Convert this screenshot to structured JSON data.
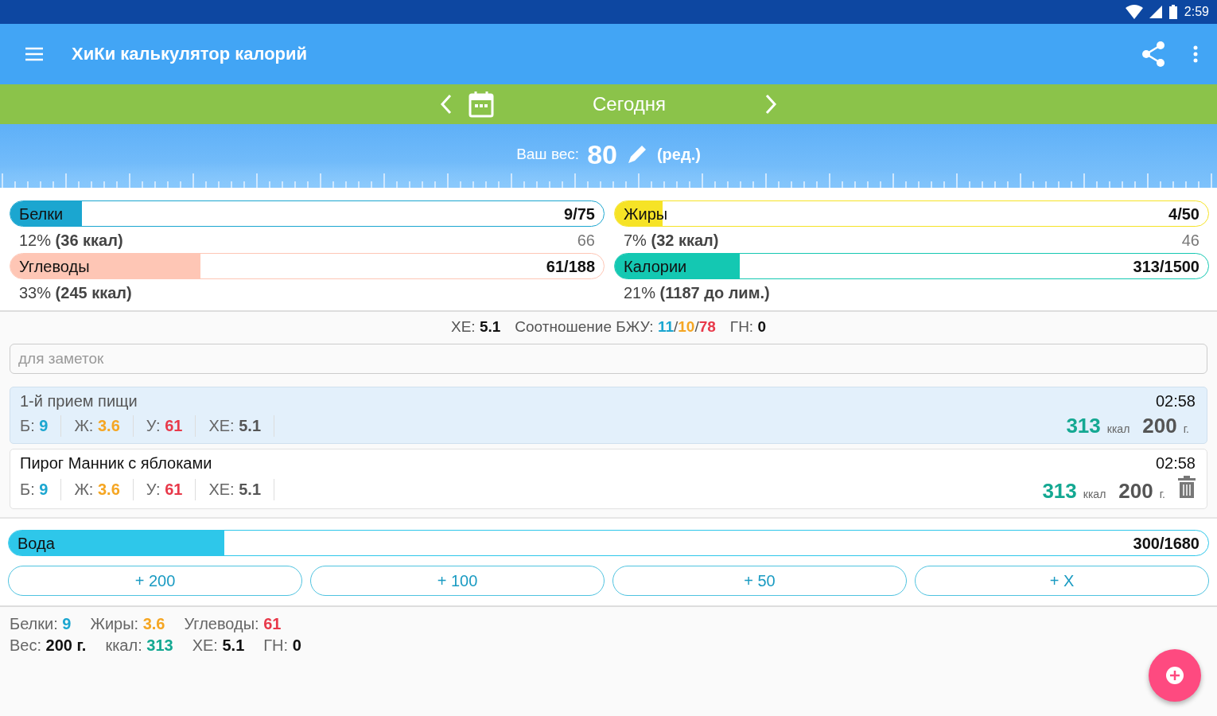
{
  "status_bar": {
    "time": "2:59"
  },
  "app_bar": {
    "title": "ХиКи калькулятор калорий"
  },
  "date_bar": {
    "label": "Сегодня"
  },
  "weight": {
    "label": "Ваш вес:",
    "value": "80",
    "edit": "(ред.)"
  },
  "macros": [
    {
      "label": "Белки",
      "value": "9/75",
      "level": 0.12,
      "color": "#1ba6d0",
      "note": "12% **(36 ккал)**",
      "rest": "66"
    },
    {
      "label": "Жиры",
      "value": "4/50",
      "level": 0.08,
      "color": "#f6e326",
      "note": "7% **(32 ккал)**",
      "rest": "46"
    },
    {
      "label": "Углеводы",
      "value": "61/188",
      "level": 0.32,
      "color": "#fec6b5",
      "note": "33% **(245 ккал)**"
    },
    {
      "label": "Калории",
      "value": "313/1500",
      "level": 0.21,
      "color": "#14c8b2",
      "note": "21% **(1187 до лим.)**"
    }
  ],
  "summary": {
    "xe_label": "ХЕ:",
    "xe": "5.1",
    "ratio_label": "Соотношение БЖУ:",
    "separator": "/",
    "ratio": [
      {
        "text": "11",
        "color": "#1ba6d0"
      },
      {
        "text": "10",
        "color": "#f5a623"
      },
      {
        "text": "78",
        "color": "#e8394a"
      }
    ],
    "gn_label": "ГН:",
    "gn": "0"
  },
  "notes": {
    "placeholder": "для заметок"
  },
  "entries": [
    {
      "kind": "meal",
      "title": "1-й прием пищи",
      "time": "02:58",
      "stats": [
        {
          "label": "Б:",
          "value": "9",
          "color": "#1ba6d0"
        },
        {
          "label": "Ж:",
          "value": "3.6",
          "color": "#f5a623"
        },
        {
          "label": "У:",
          "value": "61",
          "color": "#e8394a"
        },
        {
          "label": "ХЕ:",
          "value": "5.1",
          "color": "#555555"
        }
      ],
      "kcal": "313",
      "kcal_unit": "ккал",
      "weight": "200",
      "weight_unit": "г."
    },
    {
      "kind": "food",
      "title": "Пирог Манник с яблоками",
      "time": "02:58",
      "stats": [
        {
          "label": "Б:",
          "value": "9",
          "color": "#1ba6d0"
        },
        {
          "label": "Ж:",
          "value": "3.6",
          "color": "#f5a623"
        },
        {
          "label": "У:",
          "value": "61",
          "color": "#e8394a"
        },
        {
          "label": "ХЕ:",
          "value": "5.1",
          "color": "#555555"
        }
      ],
      "kcal": "313",
      "kcal_unit": "ккал",
      "weight": "200",
      "weight_unit": "г."
    }
  ],
  "water": {
    "label": "Вода",
    "value": "300/1680",
    "level": 0.18,
    "buttons": [
      "+ 200",
      "+ 100",
      "+ 50",
      "+ X"
    ]
  },
  "totals": [
    [
      {
        "label": "Белки:",
        "value": "9",
        "color": "#1ba6d0"
      },
      {
        "label": "Жиры:",
        "value": "3.6",
        "color": "#f5a623"
      },
      {
        "label": "Углеводы:",
        "value": "61",
        "color": "#e8394a"
      }
    ],
    [
      {
        "label": "Вес:",
        "value": "200 г.",
        "color": "#111111"
      },
      {
        "label": "ккал:",
        "value": "313",
        "color": "#14a892"
      },
      {
        "label": "ХЕ:",
        "value": "5.1",
        "color": "#111111"
      },
      {
        "label": "ГН:",
        "value": "0",
        "color": "#111111"
      }
    ]
  ]
}
